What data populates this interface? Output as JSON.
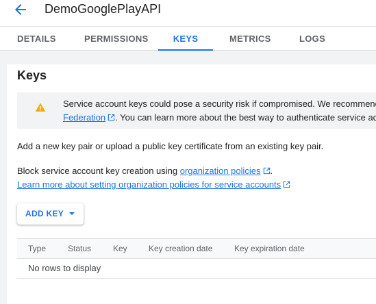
{
  "header": {
    "back_icon": "arrow-back-icon",
    "title": "DemoGooglePlayAPI"
  },
  "tabs": [
    {
      "label": "DETAILS",
      "active": false
    },
    {
      "label": "PERMISSIONS",
      "active": false
    },
    {
      "label": "KEYS",
      "active": true
    },
    {
      "label": "METRICS",
      "active": false
    },
    {
      "label": "LOGS",
      "active": false
    }
  ],
  "keys": {
    "heading": "Keys",
    "warning": {
      "icon": "warning-icon",
      "line1": "Service account keys could pose a security risk if compromised. We recommend",
      "link": "Federation",
      "line2_rest": ". You can learn more about the best way to authenticate service accounts"
    },
    "intro": "Add a new key pair or upload a public key certificate from an existing key pair.",
    "block_text": "Block service account key creation using ",
    "org_policies_link": "organization policies",
    "block_period": ".",
    "learn_more_link": "Learn more about setting organization policies for service accounts",
    "add_key_label": "ADD KEY",
    "table": {
      "columns": [
        "Type",
        "Status",
        "Key",
        "Key creation date",
        "Key expiration date"
      ],
      "empty_text": "No rows to display"
    }
  },
  "colors": {
    "accent": "#1a73e8",
    "warning": "#f9ab00",
    "background": "#f1f3f4"
  }
}
